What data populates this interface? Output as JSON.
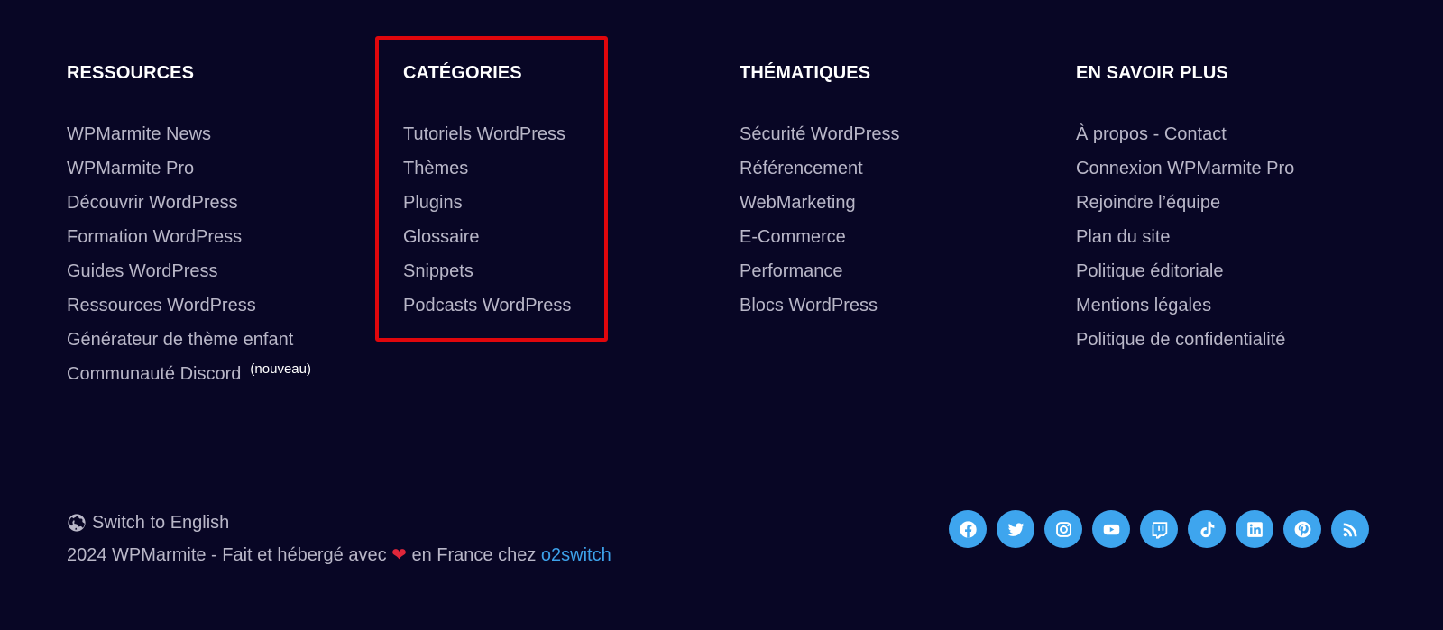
{
  "columns": [
    {
      "title": "RESSOURCES",
      "items": [
        "WPMarmite News",
        "WPMarmite Pro",
        "Découvrir WordPress",
        "Formation WordPress",
        "Guides WordPress",
        "Ressources WordPress",
        "Générateur de thème enfant",
        "Communauté Discord"
      ],
      "badge": "(nouveau)"
    },
    {
      "title": "CATÉGORIES",
      "items": [
        "Tutoriels WordPress",
        "Thèmes",
        "Plugins",
        "Glossaire",
        "Snippets",
        "Podcasts WordPress"
      ]
    },
    {
      "title": "THÉMATIQUES",
      "items": [
        "Sécurité WordPress",
        "Référencement",
        "WebMarketing",
        "E-Commerce",
        "Performance",
        "Blocs WordPress"
      ]
    },
    {
      "title": "EN SAVOIR PLUS",
      "items": [
        "À propos - Contact",
        "Connexion WPMarmite Pro",
        "Rejoindre l’équipe",
        "Plan du site",
        "Politique éditoriale",
        "Mentions légales",
        "Politique de confidentialité"
      ]
    }
  ],
  "bottom": {
    "switch_language": "Switch to English",
    "copyright_prefix": "2024 WPMarmite - Fait et hébergé avec",
    "heart": "❤",
    "copyright_middle": "en France chez",
    "host_link": "o2switch"
  },
  "socials": [
    "facebook-icon",
    "twitter-icon",
    "instagram-icon",
    "youtube-icon",
    "twitch-icon",
    "tiktok-icon",
    "linkedin-icon",
    "pinterest-icon",
    "rss-icon"
  ],
  "colors": {
    "background": "#080625",
    "heading": "#ffffff",
    "link": "#b9b7c8",
    "accent": "#3ea5ee",
    "highlight": "#e0060c"
  }
}
